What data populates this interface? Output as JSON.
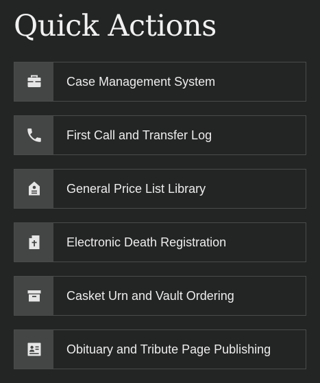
{
  "header": {
    "title": "Quick Actions"
  },
  "actions": [
    {
      "label": "Case Management System",
      "icon": "briefcase-icon"
    },
    {
      "label": "First Call and Transfer Log",
      "icon": "phone-icon"
    },
    {
      "label": "General Price List Library",
      "icon": "price-tag-icon"
    },
    {
      "label": "Electronic Death Registration",
      "icon": "document-cross-icon"
    },
    {
      "label": "Casket Urn and Vault Ordering",
      "icon": "archive-box-icon"
    },
    {
      "label": "Obituary and Tribute Page Publishing",
      "icon": "profile-card-icon"
    }
  ],
  "colors": {
    "background": "#232424",
    "icon_tile": "#444545",
    "border": "#4a4b4b",
    "text": "#ededed",
    "icon": "#e6e6e6"
  }
}
